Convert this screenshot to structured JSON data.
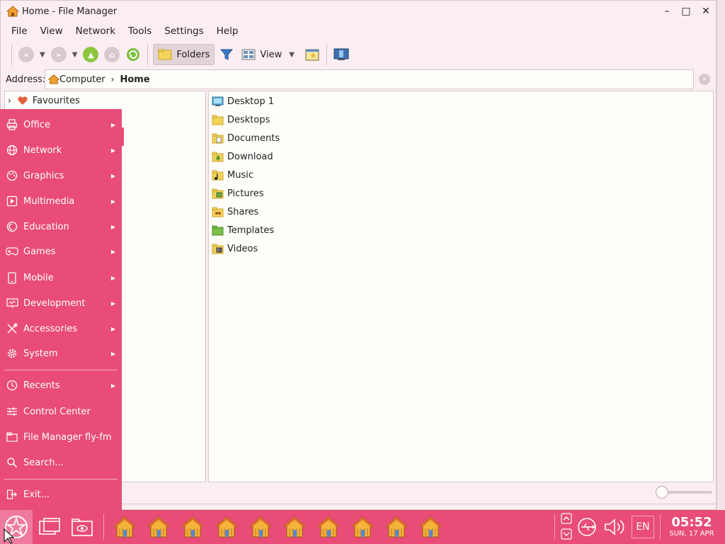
{
  "window": {
    "title": "Home - File Manager",
    "controls": {
      "minimize": "–",
      "maximize": "□",
      "close": "✕"
    }
  },
  "menubar": {
    "items": [
      "File",
      "View",
      "Network",
      "Tools",
      "Settings",
      "Help"
    ]
  },
  "toolbar": {
    "folders_label": "Folders",
    "view_label": "View"
  },
  "address": {
    "label": "Address:",
    "crumbs": [
      "Computer",
      "Home"
    ]
  },
  "tree": {
    "items": [
      {
        "label": "Favourites"
      }
    ]
  },
  "files": {
    "items": [
      {
        "name": "Desktop 1",
        "icon": "desktop-icon"
      },
      {
        "name": "Desktops",
        "icon": "folder-icon"
      },
      {
        "name": "Documents",
        "icon": "documents-folder-icon"
      },
      {
        "name": "Download",
        "icon": "download-folder-icon"
      },
      {
        "name": "Music",
        "icon": "music-folder-icon"
      },
      {
        "name": "Pictures",
        "icon": "pictures-folder-icon"
      },
      {
        "name": "Shares",
        "icon": "shares-folder-icon"
      },
      {
        "name": "Templates",
        "icon": "templates-folder-icon"
      },
      {
        "name": "Videos",
        "icon": "videos-folder-icon"
      }
    ]
  },
  "start_menu": {
    "categories": [
      {
        "label": "Office",
        "icon": "printer-icon"
      },
      {
        "label": "Network",
        "icon": "globe-icon"
      },
      {
        "label": "Graphics",
        "icon": "palette-icon"
      },
      {
        "label": "Multimedia",
        "icon": "play-icon"
      },
      {
        "label": "Education",
        "icon": "education-icon"
      },
      {
        "label": "Games",
        "icon": "gamepad-icon"
      },
      {
        "label": "Mobile",
        "icon": "phone-icon"
      },
      {
        "label": "Development",
        "icon": "monitor-code-icon"
      },
      {
        "label": "Accessories",
        "icon": "tools-icon"
      },
      {
        "label": "System",
        "icon": "gear-icon"
      }
    ],
    "recents": {
      "label": "Recents",
      "icon": "clock-icon"
    },
    "apps": [
      {
        "label": "Control Center",
        "icon": "sliders-icon"
      },
      {
        "label": "File Manager fly-fm",
        "icon": "folder-icon"
      },
      {
        "label": "Search...",
        "icon": "search-icon"
      }
    ],
    "exit": {
      "label": "Exit...",
      "icon": "exit-icon"
    }
  },
  "taskbar": {
    "house_count": 10,
    "language": "EN",
    "time": "05:52",
    "date": "SUN, 17 APR"
  },
  "colors": {
    "accent": "#e84c77",
    "window_bg": "#fbeef3",
    "pane_bg": "#fffdfa",
    "folder_yellow": "#f3d35a"
  }
}
